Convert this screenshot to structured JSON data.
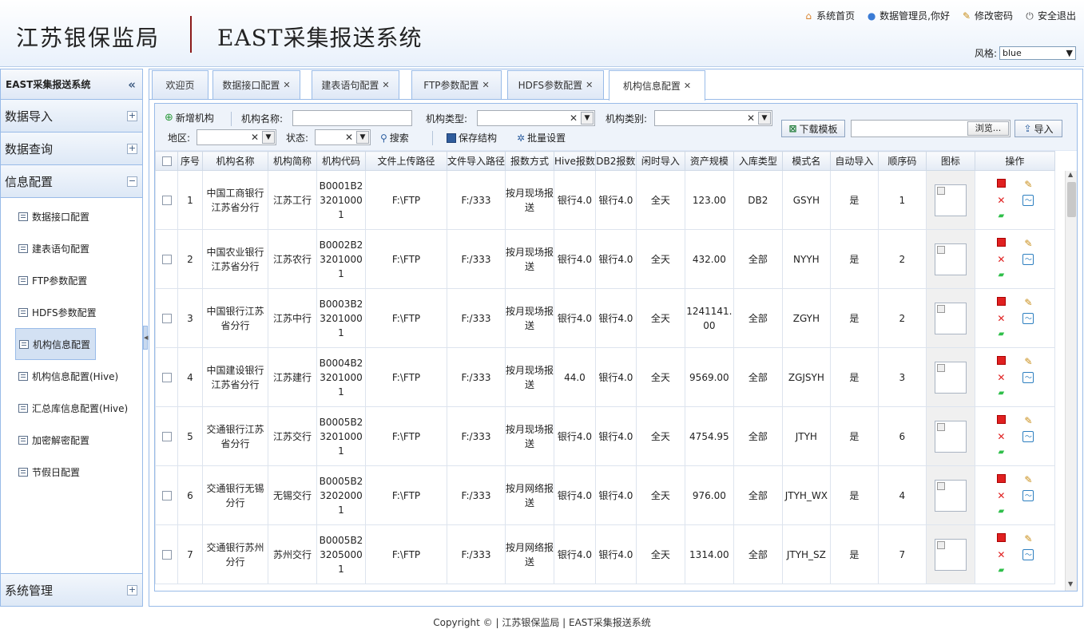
{
  "header": {
    "org": "江苏银保监局",
    "system": "EAST采集报送系统",
    "links": [
      {
        "icon": "home-icon",
        "label": "系统首页"
      },
      {
        "icon": "user-icon",
        "label": "数据管理员,你好"
      },
      {
        "icon": "edit-icon",
        "label": "修改密码"
      },
      {
        "icon": "power-icon",
        "label": "安全退出"
      }
    ],
    "style_label": "风格:",
    "style_value": "blue"
  },
  "sidebar": {
    "title": "EAST采集报送系统",
    "collapse_glyph": "«",
    "groups": [
      {
        "label": "数据导入",
        "toggle": "+"
      },
      {
        "label": "数据查询",
        "toggle": "+"
      },
      {
        "label": "信息配置",
        "toggle": "−"
      }
    ],
    "items": [
      {
        "label": "数据接口配置"
      },
      {
        "label": "建表语句配置"
      },
      {
        "label": "FTP参数配置"
      },
      {
        "label": "HDFS参数配置"
      },
      {
        "label": "机构信息配置"
      },
      {
        "label": "机构信息配置(Hive)"
      },
      {
        "label": "汇总库信息配置(Hive)"
      },
      {
        "label": "加密解密配置"
      },
      {
        "label": "节假日配置"
      }
    ],
    "footer_group": {
      "label": "系统管理",
      "toggle": "+"
    }
  },
  "tabs": [
    {
      "label": "欢迎页",
      "close": ""
    },
    {
      "label": "数据接口配置",
      "close": "✕"
    },
    {
      "label": "建表语句配置",
      "close": "✕"
    },
    {
      "label": "FTP参数配置",
      "close": "✕"
    },
    {
      "label": "HDFS参数配置",
      "close": "✕"
    },
    {
      "label": "机构信息配置",
      "close": "✕"
    }
  ],
  "toolbar": {
    "add_label": "新增机构",
    "name_label": "机构名称:",
    "type_label": "机构类型:",
    "category_label": "机构类别:",
    "region_label": "地区:",
    "status_label": "状态:",
    "search_label": "搜索",
    "save_label": "保存结构",
    "batch_label": "批量设置",
    "download_label": "下载模板",
    "browse_label": "浏览...",
    "import_label": "导入",
    "clear_glyph": "✕",
    "drop_glyph": "▼"
  },
  "grid": {
    "columns": [
      "序号",
      "机构名称",
      "机构简称",
      "机构代码",
      "文件上传路径",
      "文件导入路径",
      "报数方式",
      "Hive报数",
      "DB2报数",
      "闲时导入",
      "资产规模",
      "入库类型",
      "模式名",
      "自动导入",
      "顺序码",
      "图标",
      "操作"
    ],
    "rows": [
      [
        "1",
        "中国工商银行江苏省分行",
        "江苏工行",
        "B0001B232010001",
        "F:\\FTP",
        "F:/333",
        "按月现场报送",
        "银行4.0",
        "银行4.0",
        "全天",
        "123.00",
        "DB2",
        "GSYH",
        "是",
        "1"
      ],
      [
        "2",
        "中国农业银行江苏省分行",
        "江苏农行",
        "B0002B232010001",
        "F:\\FTP",
        "F:/333",
        "按月现场报送",
        "银行4.0",
        "银行4.0",
        "全天",
        "432.00",
        "全部",
        "NYYH",
        "是",
        "2"
      ],
      [
        "3",
        "中国银行江苏省分行",
        "江苏中行",
        "B0003B232010001",
        "F:\\FTP",
        "F:/333",
        "按月现场报送",
        "银行4.0",
        "银行4.0",
        "全天",
        "1241141.00",
        "全部",
        "ZGYH",
        "是",
        "2"
      ],
      [
        "4",
        "中国建设银行江苏省分行",
        "江苏建行",
        "B0004B232010001",
        "F:\\FTP",
        "F:/333",
        "按月现场报送",
        "44.0",
        "银行4.0",
        "全天",
        "9569.00",
        "全部",
        "ZGJSYH",
        "是",
        "3"
      ],
      [
        "5",
        "交通银行江苏省分行",
        "江苏交行",
        "B0005B232010001",
        "F:\\FTP",
        "F:/333",
        "按月现场报送",
        "银行4.0",
        "银行4.0",
        "全天",
        "4754.95",
        "全部",
        "JTYH",
        "是",
        "6"
      ],
      [
        "6",
        "交通银行无锡分行",
        "无锡交行",
        "B0005B232020001",
        "F:\\FTP",
        "F:/333",
        "按月网络报送",
        "银行4.0",
        "银行4.0",
        "全天",
        "976.00",
        "全部",
        "JTYH_WX",
        "是",
        "4"
      ],
      [
        "7",
        "交通银行苏州分行",
        "苏州交行",
        "B0005B232050001",
        "F:\\FTP",
        "F:/333",
        "按月网络报送",
        "银行4.0",
        "银行4.0",
        "全天",
        "1314.00",
        "全部",
        "JTYH_SZ",
        "是",
        "7"
      ]
    ],
    "op_icons": {
      "stop": "stop-icon",
      "edit": "pencil-icon",
      "delete": "delete-icon",
      "chart": "chart-icon",
      "eraser": "eraser-icon"
    },
    "glyphs": {
      "edit": "✎",
      "delete": "✕",
      "chart": "〜",
      "eraser": "▰"
    }
  },
  "footer": "Copyright © | 江苏银保监局 | EAST采集报送系统"
}
